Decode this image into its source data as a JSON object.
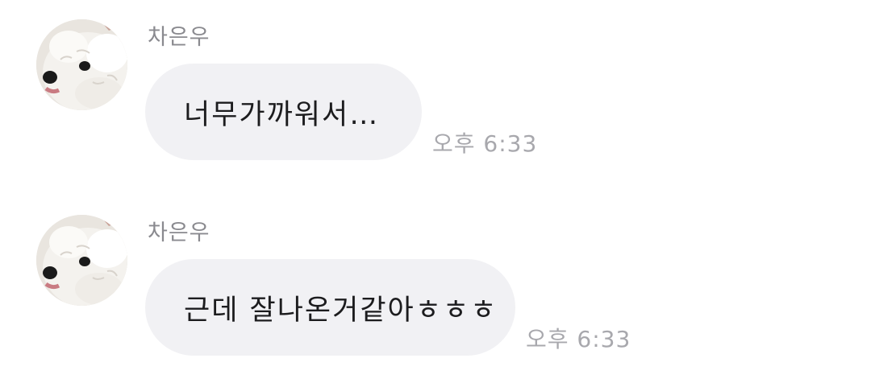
{
  "messages": [
    {
      "sender": "차은우",
      "avatar_icon": "dog-avatar-icon",
      "text": "너무가까워서…",
      "time": "오후 6:33"
    },
    {
      "sender": "차은우",
      "avatar_icon": "dog-avatar-icon",
      "text": "근데 잘나온거같아ㅎㅎㅎ",
      "time": "오후 6:33"
    }
  ],
  "colors": {
    "background": "#ffffff",
    "bubble": "#f1f1f4",
    "sender_text": "#8a8a8f",
    "message_text": "#1c1c1e",
    "time_text": "#a8a8ad"
  }
}
